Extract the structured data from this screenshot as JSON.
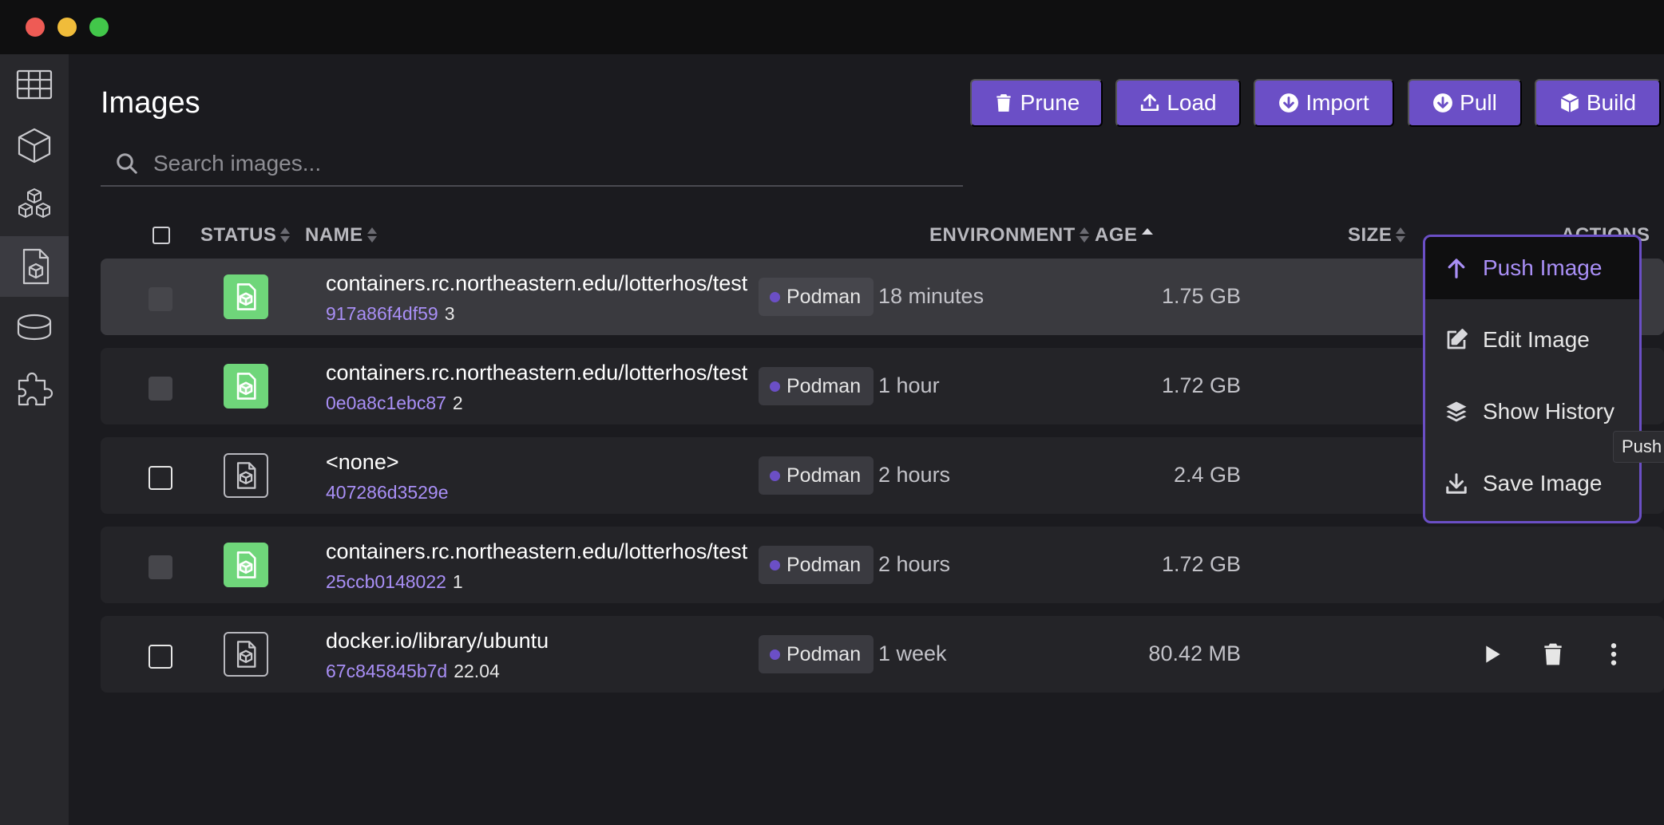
{
  "window": {
    "traffic_lights": [
      "close",
      "minimize",
      "zoom"
    ]
  },
  "sidebar": {
    "items": [
      {
        "icon": "dashboard-grid-icon",
        "active": false
      },
      {
        "icon": "containers-cube-icon",
        "active": false
      },
      {
        "icon": "pods-cubes-icon",
        "active": false
      },
      {
        "icon": "images-icon",
        "active": true
      },
      {
        "icon": "volumes-disk-icon",
        "active": false
      },
      {
        "icon": "extensions-puzzle-icon",
        "active": false
      }
    ]
  },
  "header": {
    "title": "Images",
    "buttons": {
      "prune": "Prune",
      "load": "Load",
      "import": "Import",
      "pull": "Pull",
      "build": "Build"
    }
  },
  "search": {
    "placeholder": "Search images...",
    "value": ""
  },
  "table": {
    "columns": {
      "status": "STATUS",
      "name": "NAME",
      "environment": "ENVIRONMENT",
      "age": "AGE",
      "size": "SIZE",
      "actions": "ACTIONS"
    },
    "rows": [
      {
        "status": "used",
        "name": "containers.rc.northeastern.edu/lotterhos/test",
        "id": "917a86f4df59",
        "tag": "3",
        "environment": "Podman",
        "age": "18 minutes",
        "size": "1.75 GB"
      },
      {
        "status": "used",
        "name": "containers.rc.northeastern.edu/lotterhos/test",
        "id": "0e0a8c1ebc87",
        "tag": "2",
        "environment": "Podman",
        "age": "1 hour",
        "size": "1.72 GB"
      },
      {
        "status": "unused",
        "name": "<none>",
        "id": "407286d3529e",
        "tag": "",
        "environment": "Podman",
        "age": "2 hours",
        "size": "2.4 GB"
      },
      {
        "status": "used",
        "name": "containers.rc.northeastern.edu/lotterhos/test",
        "id": "25ccb0148022",
        "tag": "1",
        "environment": "Podman",
        "age": "2 hours",
        "size": "1.72 GB"
      },
      {
        "status": "unused",
        "name": "docker.io/library/ubuntu",
        "id": "67c845845b7d",
        "tag": "22.04",
        "environment": "Podman",
        "age": "1 week",
        "size": "80.42 MB"
      }
    ]
  },
  "context_menu": {
    "items": {
      "push": "Push Image",
      "edit": "Edit Image",
      "history": "Show History",
      "save": "Save Image"
    },
    "tooltip": "Push Image"
  },
  "colors": {
    "accent": "#6b4fc6",
    "accent_text": "#a98ff6",
    "status_green": "#6fd67a",
    "background": "#1b1b1f"
  }
}
